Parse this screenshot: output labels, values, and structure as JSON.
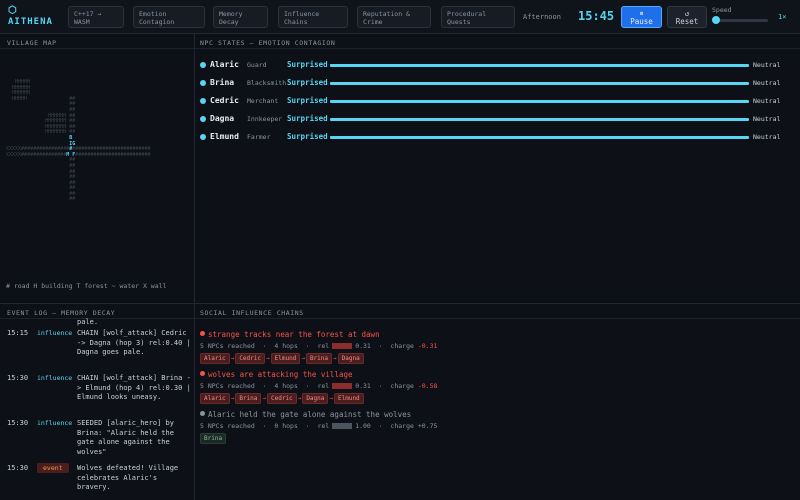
{
  "app": {
    "logo_glyph": "⬡",
    "name": "AITHENA"
  },
  "header": {
    "chips": [
      "C++17 → WASM",
      "Emotion Contagion",
      "Memory Decay",
      "Influence Chains",
      "Reputation & Crime",
      "Procedural Quests"
    ],
    "time_of_day": "Afternoon",
    "clock": "15:45",
    "pause_icon": "⏸",
    "pause_label": "Pause",
    "reset_icon": "↺",
    "reset_label": "Reset",
    "speed_label": "Speed",
    "speed_value": "1×"
  },
  "panels": {
    "map": "VILLAGE MAP",
    "npc": "NPC STATES — EMOTION CONTAGION",
    "log": "EVENT LOG — MEMORY DECAY",
    "chains": "SOCIAL INFLUENCE CHAINS"
  },
  "map_legend": "# road   H building   T forest   ~ water   X wall",
  "npcs": [
    {
      "name": "Alaric",
      "role": "Guard",
      "emotion": "Surprised",
      "end": "Neutral"
    },
    {
      "name": "Brina",
      "role": "Blacksmith",
      "emotion": "Surprised",
      "end": "Neutral"
    },
    {
      "name": "Cedric",
      "role": "Merchant",
      "emotion": "Surprised",
      "end": "Neutral"
    },
    {
      "name": "Dagna",
      "role": "Innkeeper",
      "emotion": "Surprised",
      "end": "Neutral"
    },
    {
      "name": "Elmund",
      "role": "Farmer",
      "emotion": "Surprised",
      "end": "Neutral"
    }
  ],
  "log": [
    {
      "time": "",
      "tag": "",
      "text": "pale."
    },
    {
      "time": "15:15",
      "tag": "influence",
      "text": "CHAIN [wolf_attack] Cedric -> Dagna (hop 3) rel:0.40 | Dagna goes pale."
    },
    {
      "time": "15:30",
      "tag": "influence",
      "text": "CHAIN [wolf_attack] Brina -> Elmund (hop 4) rel:0.30 | Elmund looks uneasy."
    },
    {
      "time": "15:30",
      "tag": "influence",
      "text": "SEEDED [alaric_hero] by Brina: \"Alaric held the gate alone against the wolves\""
    },
    {
      "time": "15:30",
      "tag": "event",
      "text": "Wolves defeated! Village celebrates Alaric's bravery."
    }
  ],
  "chains": [
    {
      "title": "strange tracks near the forest at dawn",
      "reached": "5 NPCs reached",
      "hops": "4 hops",
      "rel_label": "rel",
      "rel": "0.31",
      "charge_label": "charge",
      "charge": "-0.31",
      "path": [
        "Alaric",
        "Cedric",
        "Elmund",
        "Brina",
        "Dagna"
      ]
    },
    {
      "title": "wolves are attacking the village",
      "reached": "5 NPCs reached",
      "hops": "4 hops",
      "rel_label": "rel",
      "rel": "0.31",
      "charge_label": "charge",
      "charge": "-0.58",
      "path": [
        "Alaric",
        "Brina",
        "Cedric",
        "Dagna",
        "Elmund"
      ]
    },
    {
      "title": "Alaric held the gate alone against the wolves",
      "reached": "5 NPCs reached",
      "hops": "0 hops",
      "rel_label": "rel",
      "rel": "1.00",
      "charge_label": "charge",
      "charge": "+0.75",
      "path": [
        "Brina"
      ]
    }
  ],
  "colors": {
    "accent": "#58d5f2",
    "danger": "#f85149",
    "event": "#f2994a",
    "bg": "#0d1117"
  }
}
